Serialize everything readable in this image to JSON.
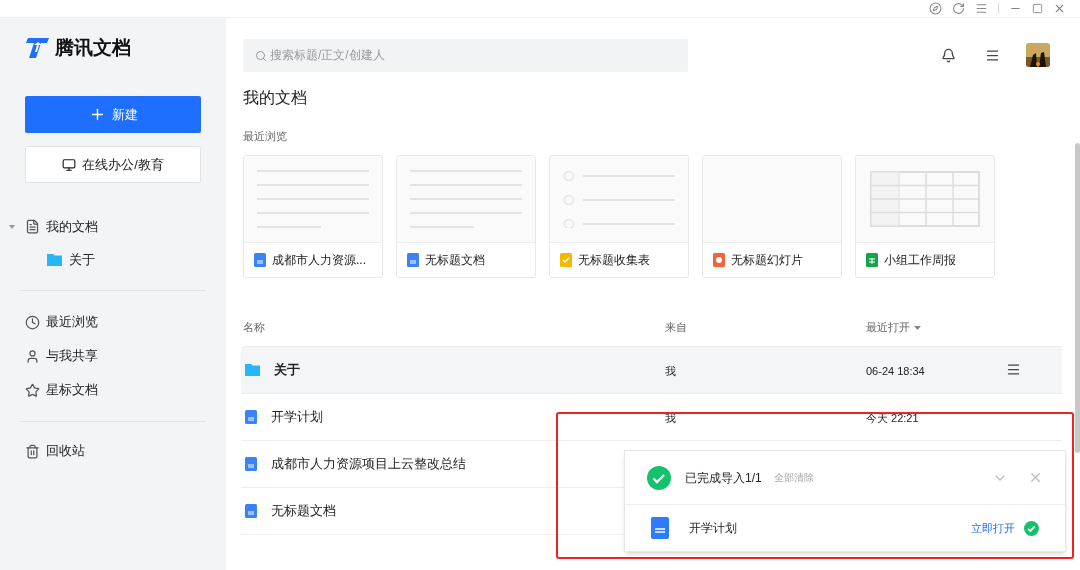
{
  "app": {
    "name": "腾讯文档"
  },
  "sidebar": {
    "new_button": "新建",
    "office_button": "在线办公/教育",
    "tree": [
      {
        "label": "我的文档",
        "kind": "docs",
        "expanded": true,
        "children": [
          {
            "label": "关于",
            "kind": "folder"
          }
        ]
      }
    ],
    "nav": [
      {
        "label": "最近浏览",
        "kind": "clock"
      },
      {
        "label": "与我共享",
        "kind": "user"
      },
      {
        "label": "星标文档",
        "kind": "star"
      }
    ],
    "trash": {
      "label": "回收站"
    }
  },
  "search": {
    "placeholder": "搜索标题/正文/创建人"
  },
  "page_title": "我的文档",
  "recent": {
    "title": "最近浏览",
    "items": [
      {
        "name": "成都市人力资源...",
        "kind": "doc"
      },
      {
        "name": "无标题文档",
        "kind": "doc"
      },
      {
        "name": "无标题收集表",
        "kind": "form"
      },
      {
        "name": "无标题幻灯片",
        "kind": "slide"
      },
      {
        "name": "小组工作周报",
        "kind": "sheet"
      }
    ]
  },
  "table": {
    "columns": [
      "名称",
      "来自",
      "最近打开"
    ],
    "rows": [
      {
        "name": "关于",
        "kind": "folder",
        "from": "我",
        "opened": "06-24 18:34",
        "selected": true
      },
      {
        "name": "开学计划",
        "kind": "doc",
        "from": "我",
        "opened": "今天 22:21",
        "selected": false
      },
      {
        "name": "成都市人力资源项目上云整改总结",
        "kind": "doc",
        "selected": false
      },
      {
        "name": "无标题文档",
        "kind": "doc",
        "selected": false
      }
    ]
  },
  "import_panel": {
    "title": "已完成导入1/1",
    "clear": "全部清除",
    "file": "开学计划",
    "open_link": "立即打开"
  }
}
